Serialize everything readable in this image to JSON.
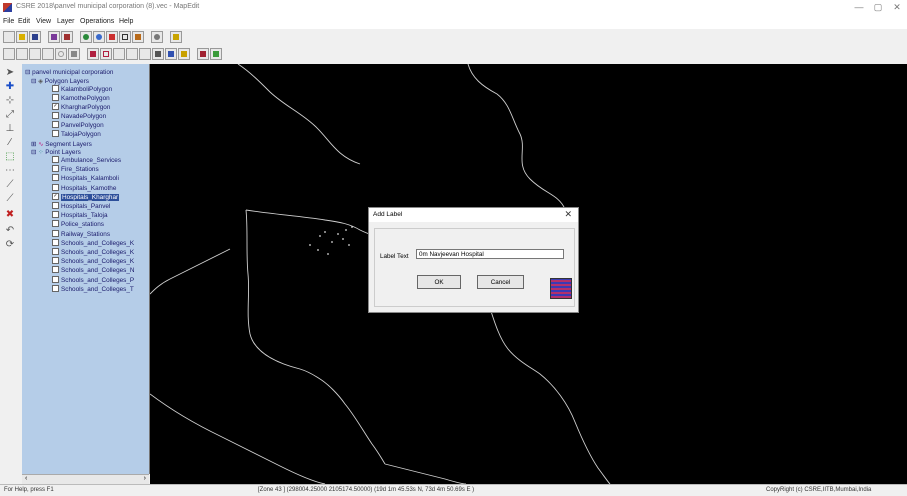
{
  "window": {
    "title": "CSRE 2018\\panvel municipal corporation (8).vec - MapEdit",
    "controls": [
      "—",
      "▢",
      "✕"
    ]
  },
  "menu": [
    "File",
    "Edit",
    "View",
    "Layer",
    "Operations",
    "Help"
  ],
  "tree": {
    "root": "panvel municipal corporation",
    "polygon_group": "Polygon Layers",
    "polygons": [
      {
        "label": "KalamboliPolygon",
        "checked": false
      },
      {
        "label": "KamothePolygon",
        "checked": false
      },
      {
        "label": "KhargharPolygon",
        "checked": true
      },
      {
        "label": "NavadePolygon",
        "checked": false
      },
      {
        "label": "PanvelPolygon",
        "checked": false
      },
      {
        "label": "TalojaPolygon",
        "checked": false
      }
    ],
    "segment_group": "Segment Layers",
    "point_group": "Point Layers",
    "points": [
      {
        "label": "Ambulance_Services",
        "checked": false
      },
      {
        "label": "Fire_Stations",
        "checked": false
      },
      {
        "label": "Hospitals_Kalamboli",
        "checked": false
      },
      {
        "label": "Hospitals_Kamothe",
        "checked": false
      },
      {
        "label": "Hospitals_Kharghar",
        "checked": true
      },
      {
        "label": "Hospitals_Panvel",
        "checked": false
      },
      {
        "label": "Hospitals_Taloja",
        "checked": false
      },
      {
        "label": "Police_stations",
        "checked": false
      },
      {
        "label": "Railway_Stations",
        "checked": false
      },
      {
        "label": "Schools_and_Colleges_K",
        "checked": false
      },
      {
        "label": "Schools_and_Colleges_K",
        "checked": false
      },
      {
        "label": "Schools_and_Colleges_K",
        "checked": false
      },
      {
        "label": "Schools_and_Colleges_N",
        "checked": false
      },
      {
        "label": "Schools_and_Colleges_P",
        "checked": false
      },
      {
        "label": "Schools_and_Colleges_T",
        "checked": false
      }
    ]
  },
  "dialog": {
    "title": "Add Label",
    "close": "✕",
    "label_text_caption": "Label Text",
    "label_text_value": "0m Navjeevan Hospital",
    "ok": "OK",
    "cancel": "Cancel"
  },
  "status": {
    "help": "For Help, press F1",
    "coords": "[Zone 43 ] (298004.25000 2105174.50000) (19d 1m 45.53s N, 73d 4m 50.69s E )",
    "copyright": "CopyRight (c) CSRE,IITB,Mumbai,India"
  },
  "colors": {
    "tree_bg": "#b5cde8",
    "map_bg": "#000000",
    "selection": "#2d4f9a"
  }
}
